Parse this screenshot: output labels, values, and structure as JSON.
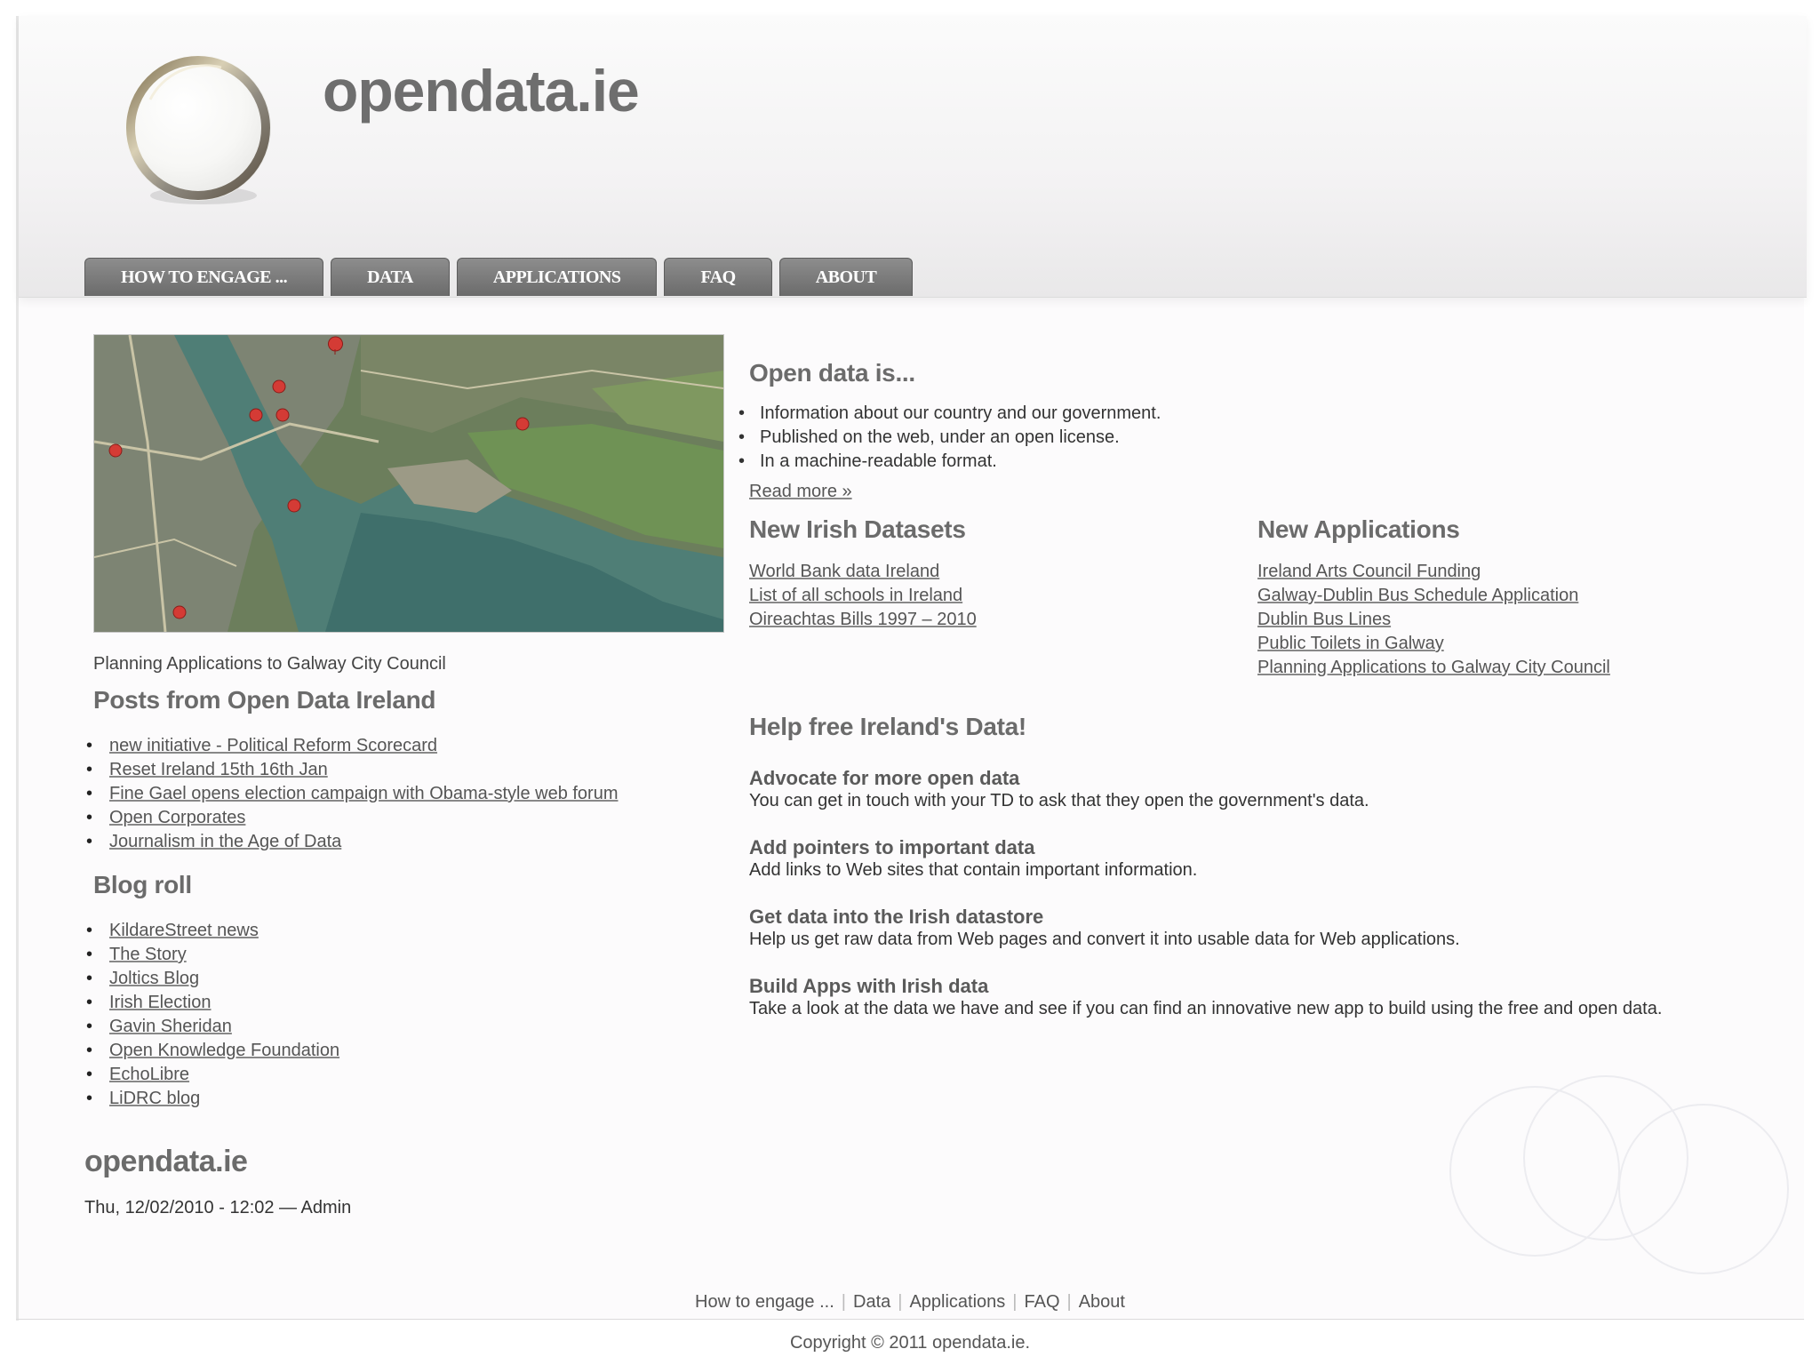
{
  "site": {
    "title": "opendata.ie"
  },
  "nav": {
    "tabs": [
      {
        "label": "HOW TO ENGAGE ..."
      },
      {
        "label": "DATA"
      },
      {
        "label": "APPLICATIONS"
      },
      {
        "label": "FAQ"
      },
      {
        "label": "ABOUT"
      }
    ]
  },
  "map": {
    "caption": "Planning Applications to Galway City Council"
  },
  "posts": {
    "heading": "Posts from Open Data Ireland",
    "items": [
      "new initiative - Political Reform Scorecard",
      "Reset Ireland 15th 16th Jan",
      "Fine Gael opens election campaign with Obama-style web forum",
      "Open Corporates",
      "Journalism in the Age of Data"
    ]
  },
  "blogroll": {
    "heading": "Blog roll",
    "items": [
      "KildareStreet news",
      "The Story",
      "Joltics Blog",
      "Irish Election",
      "Gavin Sheridan",
      "Open Knowledge Foundation",
      "EchoLibre",
      "LiDRC blog"
    ]
  },
  "node": {
    "title": "opendata.ie",
    "meta": "Thu, 12/02/2010 - 12:02 — Admin"
  },
  "open_data": {
    "heading": "Open data is...",
    "points": [
      "Information about our country and our government.",
      "Published on the web, under an open license.",
      "In a machine-readable format."
    ],
    "read_more": "Read more »"
  },
  "datasets": {
    "heading": "New Irish Datasets",
    "items": [
      "World Bank data Ireland",
      "List of all schools in Ireland",
      "Oireachtas Bills 1997 – 2010"
    ]
  },
  "applications": {
    "heading": "New Applications",
    "items": [
      "Ireland Arts Council Funding",
      "Galway-Dublin Bus Schedule Application",
      "Dublin Bus Lines",
      "Public Toilets in Galway",
      "Planning Applications to Galway City Council"
    ]
  },
  "help": {
    "heading": "Help free Ireland's Data!",
    "items": [
      {
        "title": "Advocate for more open data",
        "text": "You can get in touch with your TD to ask that they open the government's data."
      },
      {
        "title": "Add pointers to important data",
        "text": "Add links to Web sites that contain important information."
      },
      {
        "title": "Get data into the Irish datastore",
        "text": "Help us get raw data from Web pages and convert it into usable data for Web applications."
      },
      {
        "title": "Build Apps with Irish data",
        "text": "Take a look at the data we have and see if you can find an innovative new app to build using the free and open data."
      }
    ]
  },
  "footer": {
    "links": [
      "How to engage ...",
      "Data",
      "Applications",
      "FAQ",
      "About"
    ],
    "copyright": "Copyright © 2011 opendata.ie."
  },
  "colors": {
    "nav_tab": "#7a7a7a",
    "heading": "#6b6b6b",
    "map_water": "#4f7f74",
    "map_land": "#6f8a57"
  }
}
